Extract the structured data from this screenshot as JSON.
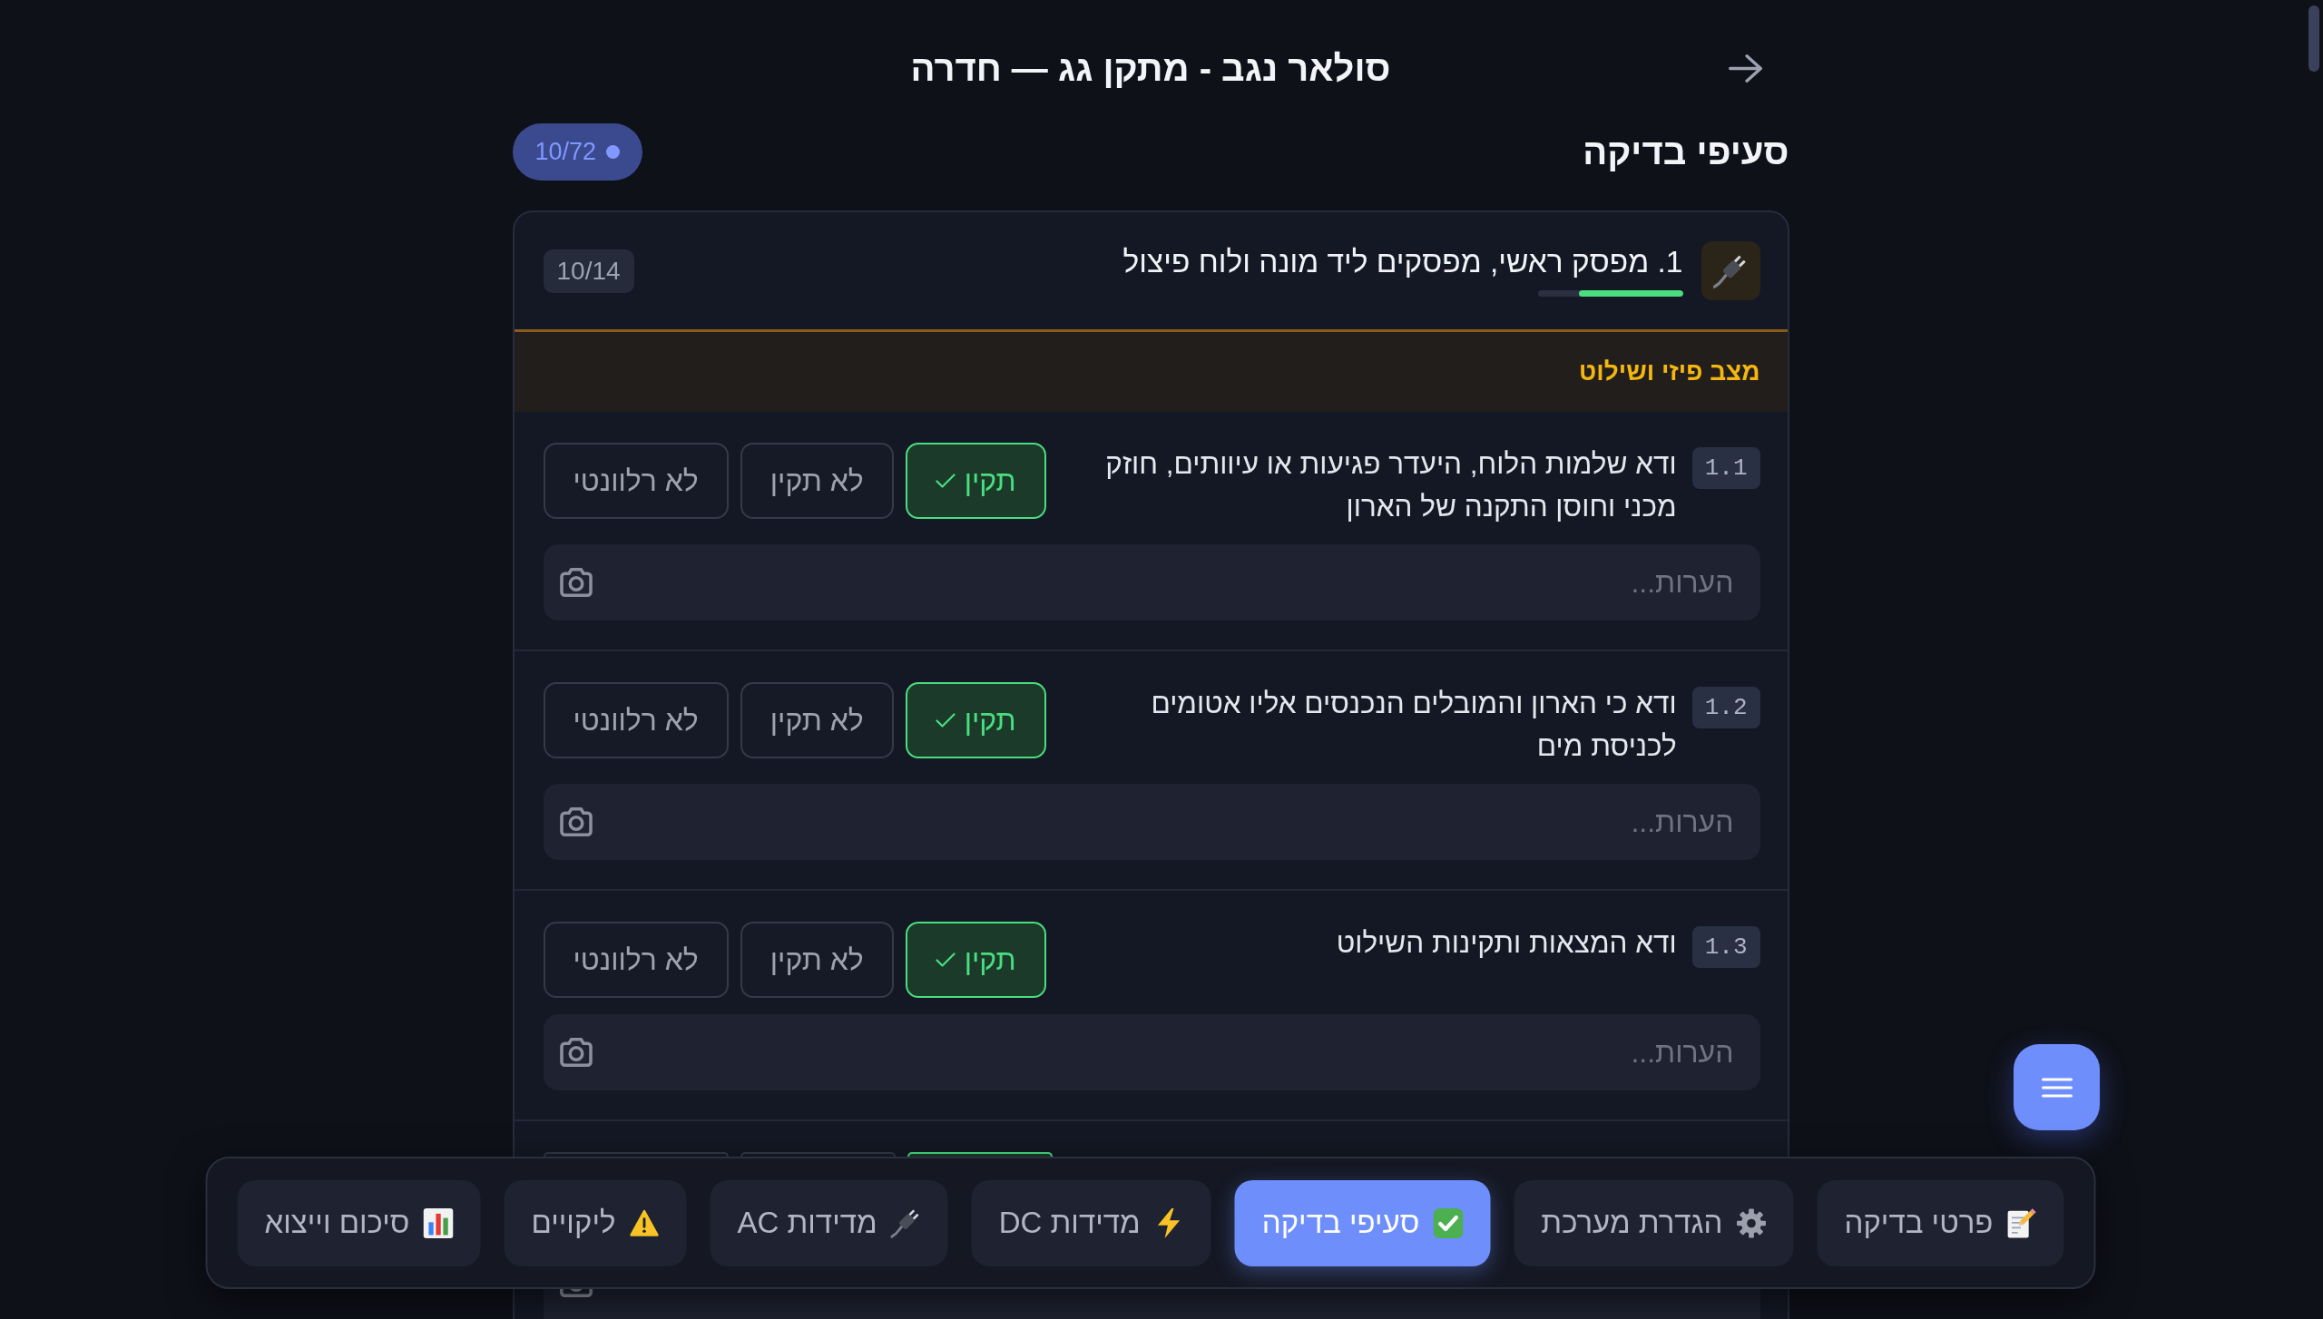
{
  "header": {
    "title": "סולאר נגב - מתקן גג — חדרה"
  },
  "section_heading": {
    "title": "סעיפי בדיקה",
    "progress": "10/72"
  },
  "section": {
    "title": "1. מפסק ראשי, מפסקים ליד מונה ולוח פיצול",
    "level": 0.714,
    "count": "10/14",
    "category": "מצב פיזי ושילוט",
    "items": [
      {
        "number": "1.1",
        "text": "ודא שלמות הלוח, היעדר פגיעות או עיוותים, חוזק מכני וחוסן התקנה של הארון",
        "options": [
          {
            "label": "תקין",
            "kind": "pass",
            "selected": true
          },
          {
            "label": "לא תקין",
            "kind": "fail",
            "selected": false
          },
          {
            "label": "לא רלוונטי",
            "kind": "na",
            "selected": false
          }
        ],
        "notes": {
          "placeholder": "הערות..."
        }
      },
      {
        "number": "1.2",
        "text": "ודא כי הארון והמובלים הנכנסים אליו אטומים לכניסת מים",
        "options": [
          {
            "label": "תקין",
            "kind": "pass",
            "selected": true
          },
          {
            "label": "לא תקין",
            "kind": "fail",
            "selected": false
          },
          {
            "label": "לא רלוונטי",
            "kind": "na",
            "selected": false
          }
        ],
        "notes": {
          "placeholder": "הערות..."
        }
      },
      {
        "number": "1.3",
        "text": "ודא המצאות ותקינות השילוט",
        "options": [
          {
            "label": "תקין",
            "kind": "pass",
            "selected": true
          },
          {
            "label": "לא תקין",
            "kind": "fail",
            "selected": false
          },
          {
            "label": "לא רלוונטי",
            "kind": "na",
            "selected": false
          }
        ],
        "notes": {
          "placeholder": "הערות..."
        }
      }
    ],
    "next_item": {
      "options": [
        {
          "kind": "pass",
          "selected": true
        },
        {
          "kind": "fail",
          "selected": false
        },
        {
          "kind": "na",
          "selected": false
        }
      ]
    }
  },
  "nav": {
    "tabs": [
      {
        "label": "פרטי בדיקה",
        "selected": false
      },
      {
        "label": "הגדרת מערכת",
        "selected": false
      },
      {
        "label": "סעיפי בדיקה",
        "selected": true
      },
      {
        "label": "מדידות DC",
        "selected": false
      },
      {
        "label": "מדידות AC",
        "selected": false
      },
      {
        "label": "ליקויים",
        "selected": false
      },
      {
        "label": "סיכום וייצוא",
        "selected": false
      }
    ]
  }
}
